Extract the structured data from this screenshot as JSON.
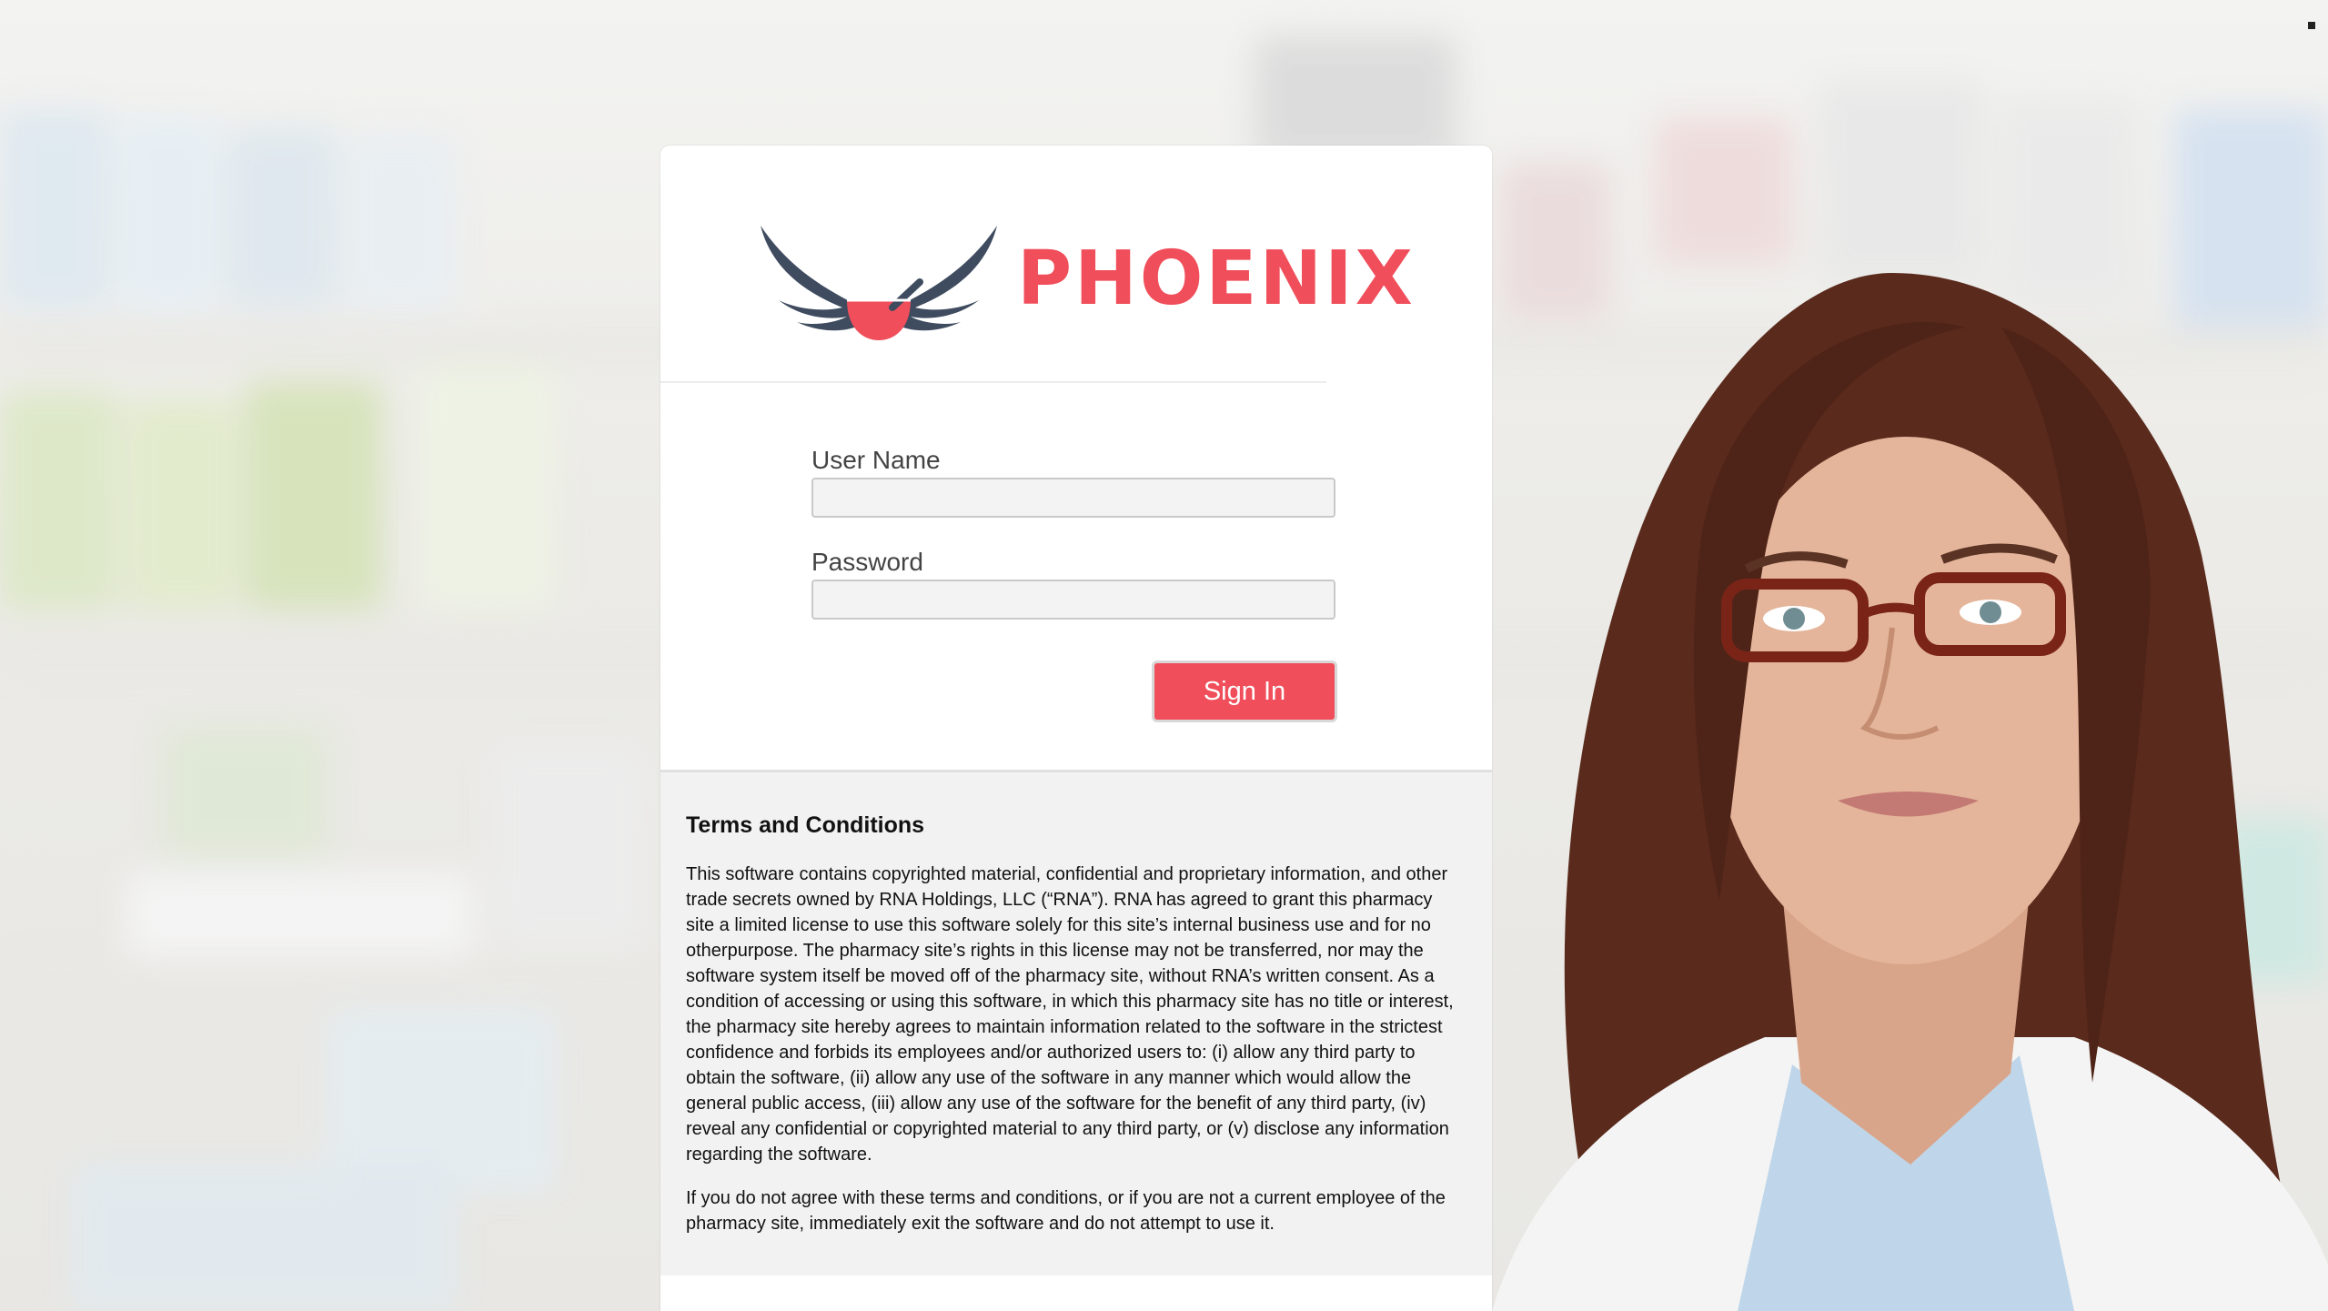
{
  "brand": {
    "name": "PHOENIX",
    "primary_color": "#f04e5a",
    "wing_color": "#3f4b5f"
  },
  "form": {
    "username_label": "User Name",
    "username_value": "",
    "password_label": "Password",
    "password_value": "",
    "signin_label": "Sign In"
  },
  "terms": {
    "title": "Terms and Conditions",
    "paragraph1": "This software contains copyrighted material, confidential and proprietary information, and other trade secrets owned by RNA Holdings, LLC (“RNA”). RNA has agreed to grant this pharmacy site a limited license to use this software solely for this site’s internal business use and for no otherpurpose. The pharmacy site’s rights in this license may not be transferred, nor may the software system itself be moved off of the pharmacy site, without RNA’s written consent. As a condition of accessing or using this software, in which this pharmacy site has no title or interest, the pharmacy site hereby agrees to maintain information related to the software in the strictest confidence and forbids its employees and/or authorized users to: (i) allow any third party to obtain the software, (ii) allow any use of the software in any manner which would allow the general public access, (iii) allow any use of the software for the benefit of any third party, (iv) reveal any confidential or copyrighted material to any third party, or (v) disclose any information regarding the software.",
    "paragraph2": "If you do not agree with these terms and conditions, or if you are not a current employee of the pharmacy site, immediately exit the software and do not attempt to use it."
  }
}
